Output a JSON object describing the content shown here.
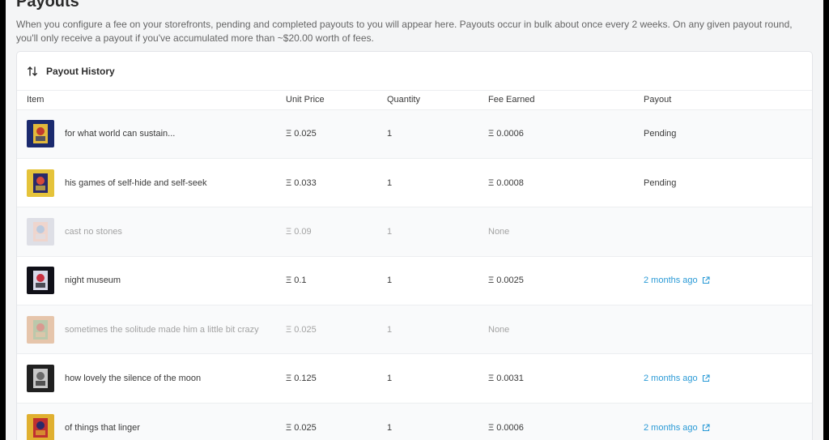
{
  "page": {
    "title": "Payouts",
    "description": "When you configure a fee on your storefronts, pending and completed payouts to you will appear here. Payouts occur in bulk about once every 2 weeks. On any given payout round, you'll only receive a payout if you've accumulated more than ~$20.00 worth of fees."
  },
  "card": {
    "title": "Payout History",
    "icon": "sort-arrows-icon"
  },
  "table": {
    "headers": {
      "item": "Item",
      "unit_price": "Unit Price",
      "quantity": "Quantity",
      "fee_earned": "Fee Earned",
      "payout": "Payout"
    },
    "rows": [
      {
        "item": "for what world can sustain...",
        "unit_price": "Ξ 0.025",
        "quantity": "1",
        "fee_earned": "Ξ 0.0006",
        "payout": "Pending",
        "payout_link": false,
        "muted": false,
        "colors": [
          "#1b2a6e",
          "#e2b93b",
          "#c23b2e"
        ]
      },
      {
        "item": "his games of self-hide and self-seek",
        "unit_price": "Ξ 0.033",
        "quantity": "1",
        "fee_earned": "Ξ 0.0008",
        "payout": "Pending",
        "payout_link": false,
        "muted": false,
        "colors": [
          "#e5c33a",
          "#2a2a6a",
          "#d64a3a"
        ]
      },
      {
        "item": "cast no stones",
        "unit_price": "Ξ 0.09",
        "quantity": "1",
        "fee_earned": "None",
        "payout": "",
        "payout_link": false,
        "muted": true,
        "colors": [
          "#c9c9d6",
          "#e7b8a8",
          "#8aa4c8"
        ]
      },
      {
        "item": "night museum",
        "unit_price": "Ξ 0.1",
        "quantity": "1",
        "fee_earned": "Ξ 0.0025",
        "payout": "2 months ago",
        "payout_link": true,
        "muted": false,
        "colors": [
          "#101018",
          "#d8d8e8",
          "#c83040"
        ]
      },
      {
        "item": "sometimes the solitude made him a little bit crazy",
        "unit_price": "Ξ 0.025",
        "quantity": "1",
        "fee_earned": "None",
        "payout": "",
        "payout_link": false,
        "muted": true,
        "colors": [
          "#d89a6a",
          "#8aa06a",
          "#c04a3a"
        ]
      },
      {
        "item": "how lovely the silence of the moon",
        "unit_price": "Ξ 0.125",
        "quantity": "1",
        "fee_earned": "Ξ 0.0031",
        "payout": "2 months ago",
        "payout_link": true,
        "muted": false,
        "colors": [
          "#202020",
          "#c8c8c8",
          "#6a6a6a"
        ]
      },
      {
        "item": "of things that linger",
        "unit_price": "Ξ 0.025",
        "quantity": "1",
        "fee_earned": "Ξ 0.0006",
        "payout": "2 months ago",
        "payout_link": true,
        "muted": false,
        "colors": [
          "#e0b030",
          "#c03030",
          "#2a2a6a"
        ]
      }
    ]
  },
  "icons": {
    "external_link": "external-link-icon"
  },
  "colors": {
    "link": "#2a9ad6",
    "muted_text": "#a3a3a3"
  }
}
